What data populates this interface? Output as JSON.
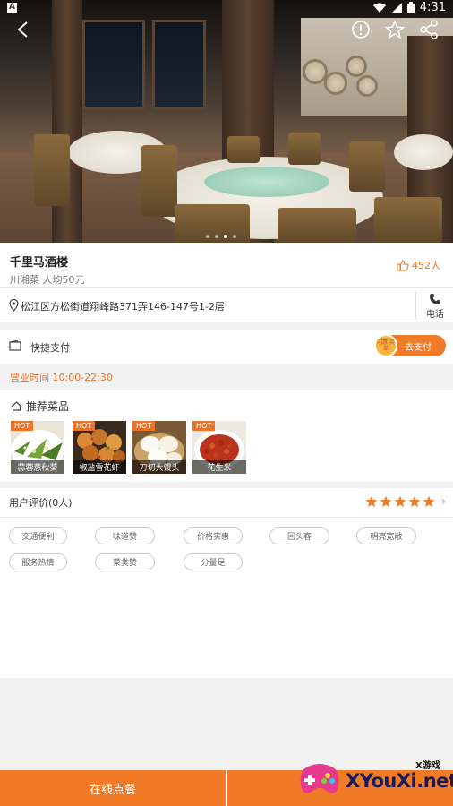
{
  "status_bar": {
    "left_icon": "A",
    "time": "4:31"
  },
  "restaurant": {
    "name": "千里马酒楼",
    "meta": "川湘菜 人均50元",
    "likes": "452人",
    "address": "松江区方松街道翔峰路371弄146-147号1-2层",
    "call_label": "电话"
  },
  "payment": {
    "label": "快捷支付",
    "button_label": "去支付",
    "badge_text": "闪惠 买单"
  },
  "hours": "营业时间 10:00-22:30",
  "dishes": {
    "title": "推荐菜品",
    "hot_label": "HOT",
    "items": [
      {
        "name": "蒜蓉葱秋葵"
      },
      {
        "name": "椒盐雪花虾"
      },
      {
        "name": "刀切大馒头"
      },
      {
        "name": "花生米"
      }
    ]
  },
  "reviews": {
    "header": "用户评价(0人)",
    "rating": 5,
    "tags": [
      "交通便利",
      "味道赞",
      "价格实惠",
      "回头客",
      "明亮宽敞",
      "服务热情",
      "菜类赞",
      "分量足"
    ]
  },
  "bottom_bar": {
    "order_label": "在线点餐"
  },
  "watermark": {
    "small": "X游戏",
    "big": "XYouXi.net"
  },
  "colors": {
    "accent": "#f07a26",
    "hours": "#e8742a",
    "star": "#f07a26"
  },
  "icons": [
    "back-icon",
    "info-icon",
    "star-icon",
    "share-icon",
    "thumbs-up-icon",
    "location-pin-icon",
    "phone-icon",
    "wallet-icon",
    "home-icon",
    "chevron-right-icon"
  ]
}
